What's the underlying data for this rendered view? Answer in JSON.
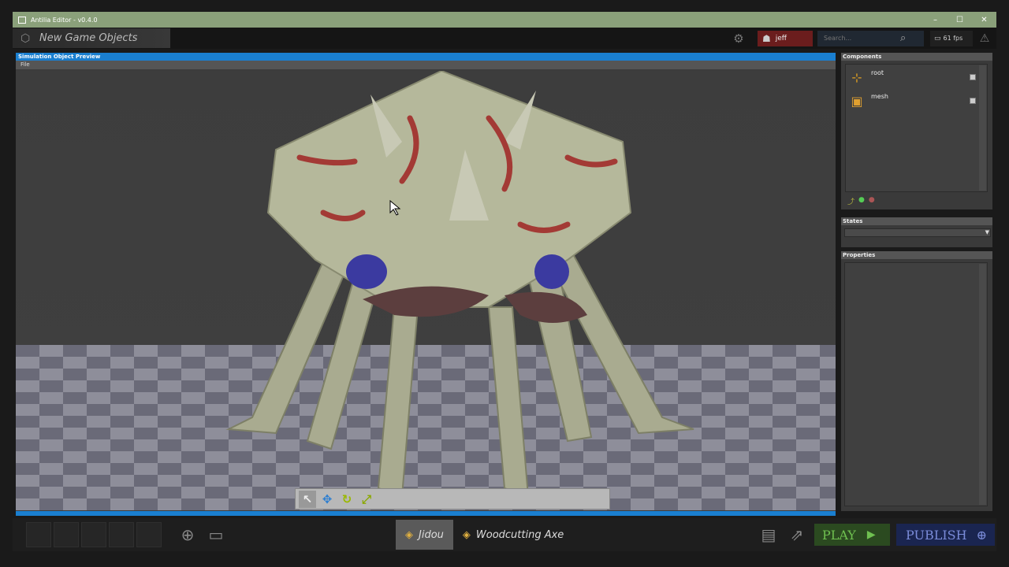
{
  "window": {
    "title": "Antilia Editor - v0.4.0",
    "controls": {
      "minimize": "–",
      "maximize": "☐",
      "close": "✕"
    }
  },
  "topbar": {
    "game_objects_label": "New Game Objects",
    "user": "jeff",
    "search_placeholder": "Search...",
    "fps": "61 fps"
  },
  "preview": {
    "title": "Simulation Object Preview",
    "menu_file": "File"
  },
  "components": {
    "title": "Components",
    "items": [
      {
        "label": "root",
        "icon": "axis-gizmo-icon"
      },
      {
        "label": "mesh",
        "icon": "mesh-box-icon"
      }
    ]
  },
  "states": {
    "title": "States",
    "selected": ""
  },
  "properties": {
    "title": "Properties"
  },
  "bottombar": {
    "tabs": [
      "Jidou",
      "Woodcutting Axe"
    ],
    "play_label": "PLAY",
    "publish_label": "PUBLISH"
  },
  "colors": {
    "accent_blue": "#1a7fd0",
    "titlebar": "#8aa07a",
    "play_green": "#6fc050",
    "publish_blue": "#7a8bd8",
    "user_red": "#6b1d1d"
  }
}
